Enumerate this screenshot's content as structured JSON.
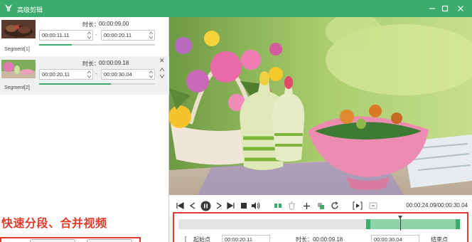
{
  "window": {
    "title": "高级剪辑",
    "minimize_icon": "minimize-icon",
    "maximize_icon": "maximize-icon",
    "close_icon": "close-icon",
    "accent": "#3cab6e"
  },
  "segments": [
    {
      "label": "Segment[1]",
      "duration_label": "时长：",
      "duration": "00:00:09.00",
      "start": "00:00:11.11",
      "end": "00:00:20.11",
      "progress": 0.28
    },
    {
      "label": "Segment[2]",
      "duration_label": "时长：",
      "duration": "00:00:09.18",
      "start": "00:00:20.11",
      "end": "00:00:30.04",
      "progress": 0.62
    }
  ],
  "separator": "-",
  "promo_text": "快速分段、合并视频",
  "player": {
    "time_readout": "00:00:24.09/00:00:30.04"
  },
  "timeline": {
    "start_label": "起始点",
    "start_value": "00:00:20.11",
    "duration_label": "时长：00:00:09.18",
    "end_value": "00:00:30.04",
    "end_label": "结束点",
    "selection_color": "#8fd3a8"
  }
}
